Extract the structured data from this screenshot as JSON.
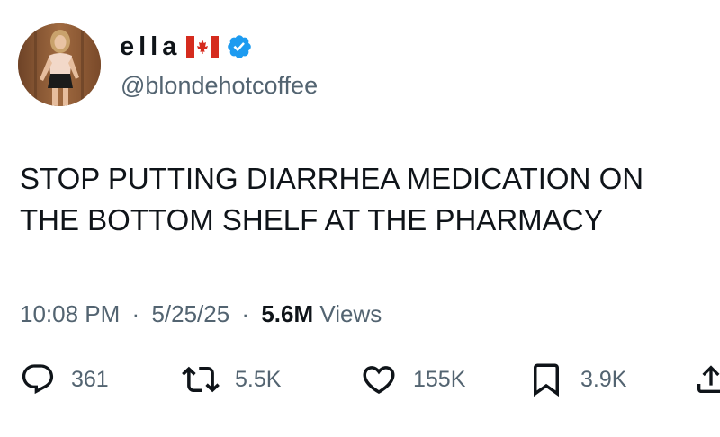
{
  "user": {
    "display_name": "ella",
    "flag_icon": "canada-flag-icon",
    "verified_icon": "verified-badge-icon",
    "handle": "@blondehotcoffee"
  },
  "tweet": {
    "text_lines": [
      "STOP PUTTING DIARRHEA MEDICATION ON",
      "THE BOTTOM SHELF AT THE PHARMACY"
    ]
  },
  "meta": {
    "time": "10:08 PM",
    "separator": "·",
    "date": "5/25/25",
    "views_count": "5.6M",
    "views_label": "Views"
  },
  "actions": {
    "replies": {
      "icon": "reply-icon",
      "count": "361"
    },
    "reposts": {
      "icon": "repost-icon",
      "count": "5.5K"
    },
    "likes": {
      "icon": "heart-icon",
      "count": "155K"
    },
    "bookmarks": {
      "icon": "bookmark-icon",
      "count": "3.9K"
    },
    "share": {
      "icon": "share-icon"
    }
  },
  "colors": {
    "text": "#0f1419",
    "secondary": "#536471",
    "verified": "#1d9bf0",
    "flag_red": "#d52b1e"
  }
}
